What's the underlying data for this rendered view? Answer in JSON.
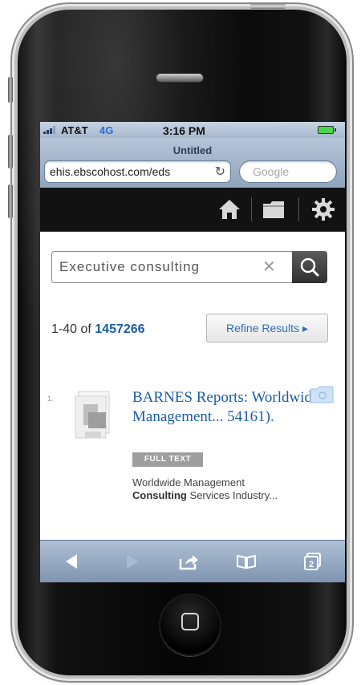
{
  "status": {
    "carrier": "AT&T",
    "network": "4G",
    "time": "3:16 PM"
  },
  "browser": {
    "page_title": "Untitled",
    "url": "ehis.ebscohost.com/eds",
    "search_placeholder": "Google"
  },
  "search": {
    "query": "Executive consulting"
  },
  "results": {
    "range": "1-40",
    "of_label": "of",
    "total": "1457266",
    "refine_label": "Refine Results ▸",
    "items": [
      {
        "number": "1.",
        "title": "BARNES Reports: Worldwide Management... 54161).",
        "badge": "FULL TEXT",
        "snippet_prefix": "Worldwide Management",
        "snippet_bold": "Consulting",
        "snippet_suffix": "Services Industry..."
      }
    ]
  },
  "toolbar": {
    "tabs_count": "2"
  },
  "colors": {
    "link_blue": "#1a5ea8",
    "chrome_blue": "#8fa4be",
    "appbar": "#121212"
  }
}
